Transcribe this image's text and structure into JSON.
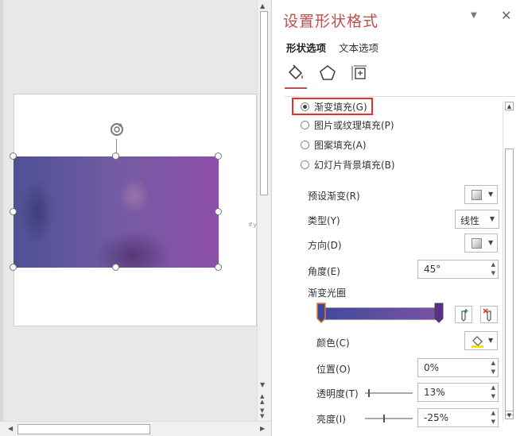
{
  "slide": {
    "text_snippet": "If y tra ext pla"
  },
  "panel": {
    "title": "设置形状格式",
    "dropdown_glyph": "▼",
    "close_glyph": "✕",
    "tabs": [
      {
        "label": "形状选项",
        "active": true
      },
      {
        "label": "文本选项",
        "active": false
      }
    ],
    "category_icons": [
      "fill-line-icon",
      "effects-pentagon-icon",
      "size-properties-icon"
    ],
    "fill_options": [
      {
        "label": "渐变填充(G)",
        "checked": true
      },
      {
        "label": "图片或纹理填充(P)",
        "checked": false
      },
      {
        "label": "图案填充(A)",
        "checked": false
      },
      {
        "label": "幻灯片背景填充(B)",
        "checked": false
      }
    ],
    "preset_gradient_label": "预设渐变(R)",
    "type_label": "类型(Y)",
    "type_value": "线性",
    "direction_label": "方向(D)",
    "angle_label": "角度(E)",
    "angle_value": "45°",
    "gradient_stops_label": "渐变光圈",
    "color_label": "颜色(C)",
    "position_label": "位置(O)",
    "position_value": "0%",
    "transparency_label": "透明度(T)",
    "transparency_value": "13%",
    "brightness_label": "亮度(I)",
    "brightness_value": "-25%"
  },
  "colors": {
    "title": "#c0504d",
    "highlight_box": "#e0312b",
    "gradient_start": "#404a9c",
    "gradient_end": "#7b52a6"
  }
}
